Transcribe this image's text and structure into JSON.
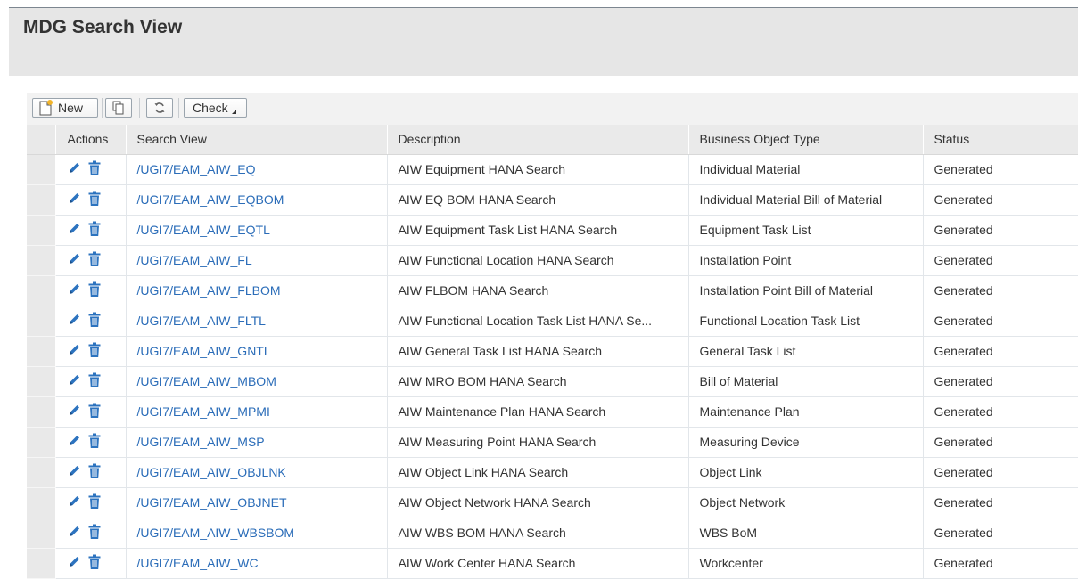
{
  "page": {
    "title": "MDG Search View"
  },
  "toolbar": {
    "new_label": "New",
    "copy_icon": "copy-icon",
    "refresh_icon": "refresh-icon",
    "check_label": "Check"
  },
  "table": {
    "headers": {
      "actions": "Actions",
      "search_view": "Search View",
      "description": "Description",
      "bo_type": "Business Object Type",
      "status": "Status"
    },
    "rows": [
      {
        "search_view": "/UGI7/EAM_AIW_EQ",
        "description": "AIW Equipment HANA Search",
        "bo_type": "Individual Material",
        "status": "Generated"
      },
      {
        "search_view": "/UGI7/EAM_AIW_EQBOM",
        "description": "AIW EQ BOM HANA Search",
        "bo_type": "Individual Material Bill of Material",
        "status": "Generated"
      },
      {
        "search_view": "/UGI7/EAM_AIW_EQTL",
        "description": "AIW Equipment Task List HANA Search",
        "bo_type": "Equipment Task List",
        "status": "Generated"
      },
      {
        "search_view": "/UGI7/EAM_AIW_FL",
        "description": "AIW Functional Location HANA Search",
        "bo_type": "Installation Point",
        "status": "Generated"
      },
      {
        "search_view": "/UGI7/EAM_AIW_FLBOM",
        "description": "AIW FLBOM HANA Search",
        "bo_type": "Installation Point Bill of Material",
        "status": "Generated"
      },
      {
        "search_view": "/UGI7/EAM_AIW_FLTL",
        "description": "AIW Functional Location Task List HANA Se...",
        "bo_type": "Functional Location Task List",
        "status": "Generated"
      },
      {
        "search_view": "/UGI7/EAM_AIW_GNTL",
        "description": "AIW General Task List HANA Search",
        "bo_type": "General Task List",
        "status": "Generated"
      },
      {
        "search_view": "/UGI7/EAM_AIW_MBOM",
        "description": "AIW MRO BOM HANA Search",
        "bo_type": "Bill of Material",
        "status": "Generated"
      },
      {
        "search_view": "/UGI7/EAM_AIW_MPMI",
        "description": "AIW Maintenance Plan HANA Search",
        "bo_type": "Maintenance Plan",
        "status": "Generated"
      },
      {
        "search_view": "/UGI7/EAM_AIW_MSP",
        "description": "AIW Measuring Point HANA Search",
        "bo_type": "Measuring Device",
        "status": "Generated"
      },
      {
        "search_view": "/UGI7/EAM_AIW_OBJLNK",
        "description": "AIW Object Link HANA Search",
        "bo_type": "Object Link",
        "status": "Generated"
      },
      {
        "search_view": "/UGI7/EAM_AIW_OBJNET",
        "description": "AIW Object Network HANA Search",
        "bo_type": "Object Network",
        "status": "Generated"
      },
      {
        "search_view": "/UGI7/EAM_AIW_WBSBOM",
        "description": "AIW WBS BOM HANA Search",
        "bo_type": "WBS BoM",
        "status": "Generated"
      },
      {
        "search_view": "/UGI7/EAM_AIW_WC",
        "description": "AIW Work Center HANA Search",
        "bo_type": "Workcenter",
        "status": "Generated"
      }
    ],
    "row_icons": [
      "edit-icon",
      "delete-icon"
    ]
  },
  "colors": {
    "link": "#2a6cb8",
    "icon": "#2c73bf",
    "header_bg": "#e6e6e6"
  }
}
